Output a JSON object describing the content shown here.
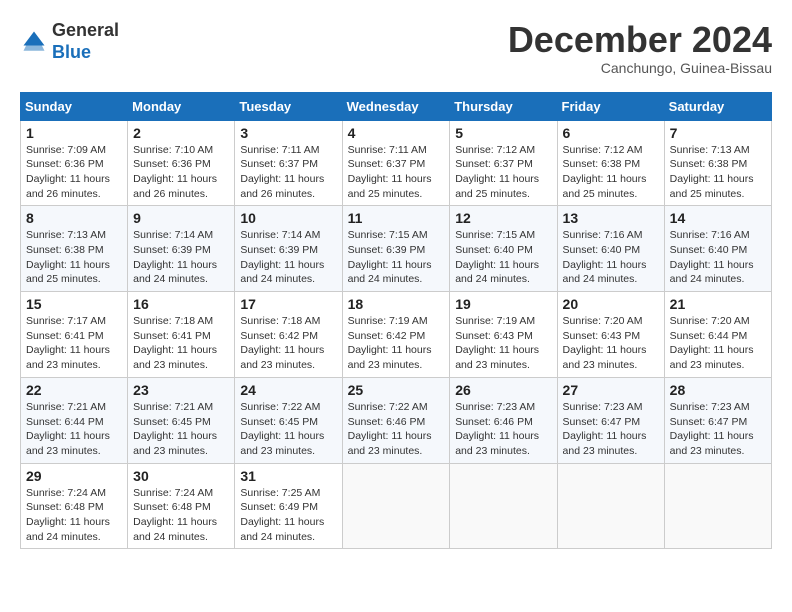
{
  "header": {
    "logo": {
      "general": "General",
      "blue": "Blue"
    },
    "title": "December 2024",
    "location": "Canchungo, Guinea-Bissau"
  },
  "calendar": {
    "headers": [
      "Sunday",
      "Monday",
      "Tuesday",
      "Wednesday",
      "Thursday",
      "Friday",
      "Saturday"
    ],
    "weeks": [
      [
        {
          "day": "1",
          "sunrise": "7:09 AM",
          "sunset": "6:36 PM",
          "daylight": "11 hours and 26 minutes."
        },
        {
          "day": "2",
          "sunrise": "7:10 AM",
          "sunset": "6:36 PM",
          "daylight": "11 hours and 26 minutes."
        },
        {
          "day": "3",
          "sunrise": "7:11 AM",
          "sunset": "6:37 PM",
          "daylight": "11 hours and 26 minutes."
        },
        {
          "day": "4",
          "sunrise": "7:11 AM",
          "sunset": "6:37 PM",
          "daylight": "11 hours and 25 minutes."
        },
        {
          "day": "5",
          "sunrise": "7:12 AM",
          "sunset": "6:37 PM",
          "daylight": "11 hours and 25 minutes."
        },
        {
          "day": "6",
          "sunrise": "7:12 AM",
          "sunset": "6:38 PM",
          "daylight": "11 hours and 25 minutes."
        },
        {
          "day": "7",
          "sunrise": "7:13 AM",
          "sunset": "6:38 PM",
          "daylight": "11 hours and 25 minutes."
        }
      ],
      [
        {
          "day": "8",
          "sunrise": "7:13 AM",
          "sunset": "6:38 PM",
          "daylight": "11 hours and 25 minutes."
        },
        {
          "day": "9",
          "sunrise": "7:14 AM",
          "sunset": "6:39 PM",
          "daylight": "11 hours and 24 minutes."
        },
        {
          "day": "10",
          "sunrise": "7:14 AM",
          "sunset": "6:39 PM",
          "daylight": "11 hours and 24 minutes."
        },
        {
          "day": "11",
          "sunrise": "7:15 AM",
          "sunset": "6:39 PM",
          "daylight": "11 hours and 24 minutes."
        },
        {
          "day": "12",
          "sunrise": "7:15 AM",
          "sunset": "6:40 PM",
          "daylight": "11 hours and 24 minutes."
        },
        {
          "day": "13",
          "sunrise": "7:16 AM",
          "sunset": "6:40 PM",
          "daylight": "11 hours and 24 minutes."
        },
        {
          "day": "14",
          "sunrise": "7:16 AM",
          "sunset": "6:40 PM",
          "daylight": "11 hours and 24 minutes."
        }
      ],
      [
        {
          "day": "15",
          "sunrise": "7:17 AM",
          "sunset": "6:41 PM",
          "daylight": "11 hours and 23 minutes."
        },
        {
          "day": "16",
          "sunrise": "7:18 AM",
          "sunset": "6:41 PM",
          "daylight": "11 hours and 23 minutes."
        },
        {
          "day": "17",
          "sunrise": "7:18 AM",
          "sunset": "6:42 PM",
          "daylight": "11 hours and 23 minutes."
        },
        {
          "day": "18",
          "sunrise": "7:19 AM",
          "sunset": "6:42 PM",
          "daylight": "11 hours and 23 minutes."
        },
        {
          "day": "19",
          "sunrise": "7:19 AM",
          "sunset": "6:43 PM",
          "daylight": "11 hours and 23 minutes."
        },
        {
          "day": "20",
          "sunrise": "7:20 AM",
          "sunset": "6:43 PM",
          "daylight": "11 hours and 23 minutes."
        },
        {
          "day": "21",
          "sunrise": "7:20 AM",
          "sunset": "6:44 PM",
          "daylight": "11 hours and 23 minutes."
        }
      ],
      [
        {
          "day": "22",
          "sunrise": "7:21 AM",
          "sunset": "6:44 PM",
          "daylight": "11 hours and 23 minutes."
        },
        {
          "day": "23",
          "sunrise": "7:21 AM",
          "sunset": "6:45 PM",
          "daylight": "11 hours and 23 minutes."
        },
        {
          "day": "24",
          "sunrise": "7:22 AM",
          "sunset": "6:45 PM",
          "daylight": "11 hours and 23 minutes."
        },
        {
          "day": "25",
          "sunrise": "7:22 AM",
          "sunset": "6:46 PM",
          "daylight": "11 hours and 23 minutes."
        },
        {
          "day": "26",
          "sunrise": "7:23 AM",
          "sunset": "6:46 PM",
          "daylight": "11 hours and 23 minutes."
        },
        {
          "day": "27",
          "sunrise": "7:23 AM",
          "sunset": "6:47 PM",
          "daylight": "11 hours and 23 minutes."
        },
        {
          "day": "28",
          "sunrise": "7:23 AM",
          "sunset": "6:47 PM",
          "daylight": "11 hours and 23 minutes."
        }
      ],
      [
        {
          "day": "29",
          "sunrise": "7:24 AM",
          "sunset": "6:48 PM",
          "daylight": "11 hours and 24 minutes."
        },
        {
          "day": "30",
          "sunrise": "7:24 AM",
          "sunset": "6:48 PM",
          "daylight": "11 hours and 24 minutes."
        },
        {
          "day": "31",
          "sunrise": "7:25 AM",
          "sunset": "6:49 PM",
          "daylight": "11 hours and 24 minutes."
        },
        null,
        null,
        null,
        null
      ]
    ]
  }
}
